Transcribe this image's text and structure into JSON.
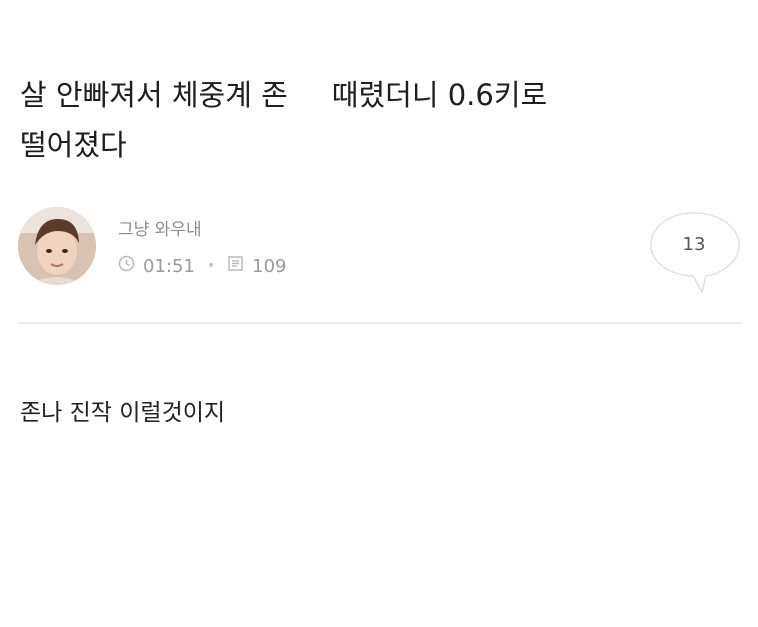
{
  "post": {
    "title_part1": "살 안빠져서 체중계 존",
    "title_part2": "때렸더니 0.6키로",
    "title_line2": "떨어졌다",
    "author": "그냥 와우내",
    "time": "01:51",
    "views": "109",
    "comment_count": "13",
    "body": "존나 진작 이럴것이지"
  },
  "icons": {
    "time": "clock-icon",
    "views": "document-icon",
    "comments": "speech-bubble-icon"
  },
  "colors": {
    "meta_text": "#9a9a9a",
    "divider": "#ededed"
  }
}
